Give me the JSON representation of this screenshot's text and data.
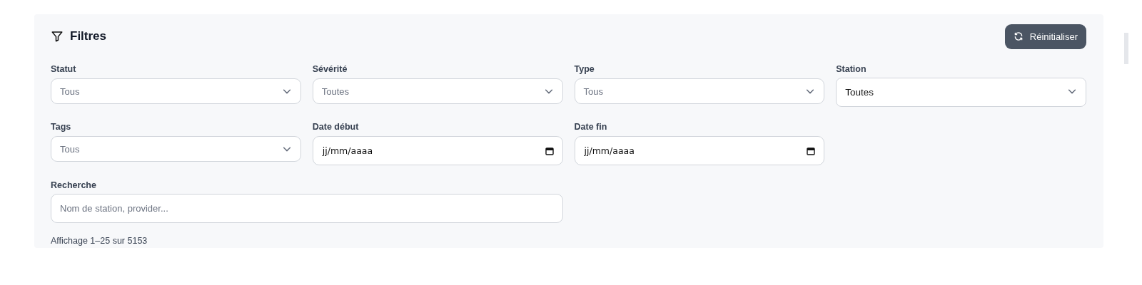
{
  "panel": {
    "title": "Filtres",
    "reset_button": "Réinitialiser"
  },
  "fields": [
    {
      "label": "Statut",
      "kind": "select",
      "value": "Tous"
    },
    {
      "label": "Sévérité",
      "kind": "select",
      "value": "Toutes"
    },
    {
      "label": "Type",
      "kind": "select",
      "value": "Tous"
    },
    {
      "label": "Station",
      "kind": "native-select",
      "value": "Toutes"
    },
    {
      "label": "Tags",
      "kind": "select",
      "value": "Tous"
    },
    {
      "label": "Date début",
      "kind": "date",
      "value": "jj/mm/aaaa"
    },
    {
      "label": "Date fin",
      "kind": "date",
      "value": "jj/mm/aaaa"
    },
    {
      "label": "Recherche",
      "kind": "search",
      "placeholder": "Nom de station, provider..."
    }
  ],
  "results_summary": "Affichage 1–25 sur 5153"
}
